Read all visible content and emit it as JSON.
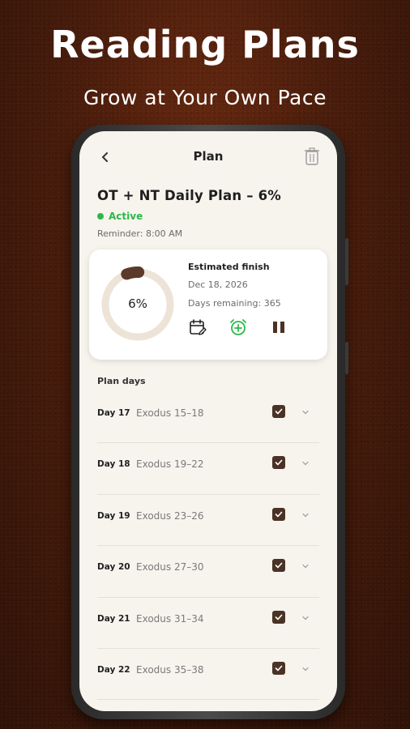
{
  "promo": {
    "headline": "Reading Plans",
    "subheadline": "Grow at Your Own Pace"
  },
  "header": {
    "title": "Plan",
    "back_icon": "chevron-left-icon",
    "delete_icon": "trash-icon"
  },
  "plan": {
    "title": "OT + NT Daily Plan – 6%",
    "status": "Active",
    "reminder": "Reminder: 8:00 AM",
    "progress_label": "6%",
    "progress_fraction": 0.06,
    "estimated_finish_label": "Estimated finish",
    "estimated_finish_date": "Dec 18, 2026",
    "days_remaining": "Days remaining: 365"
  },
  "actions": {
    "calendar_icon": "calendar-edit-icon",
    "alarm_icon": "alarm-add-icon",
    "pause_icon": "pause-icon"
  },
  "plan_days": {
    "label": "Plan days",
    "items": [
      {
        "day": "Day 17",
        "reading": "Exodus 15–18",
        "done": true
      },
      {
        "day": "Day 18",
        "reading": "Exodus 19–22",
        "done": true
      },
      {
        "day": "Day 19",
        "reading": "Exodus 23–26",
        "done": true
      },
      {
        "day": "Day 20",
        "reading": "Exodus 27–30",
        "done": true
      },
      {
        "day": "Day 21",
        "reading": "Exodus 31–34",
        "done": true
      },
      {
        "day": "Day 22",
        "reading": "Exodus 35–38",
        "done": true
      }
    ]
  },
  "colors": {
    "active": "#2db74a",
    "progress": "#5b3a2a",
    "progress_track": "#ede3d7",
    "checkbox": "#4a3326",
    "background": "#f7f4ee"
  }
}
